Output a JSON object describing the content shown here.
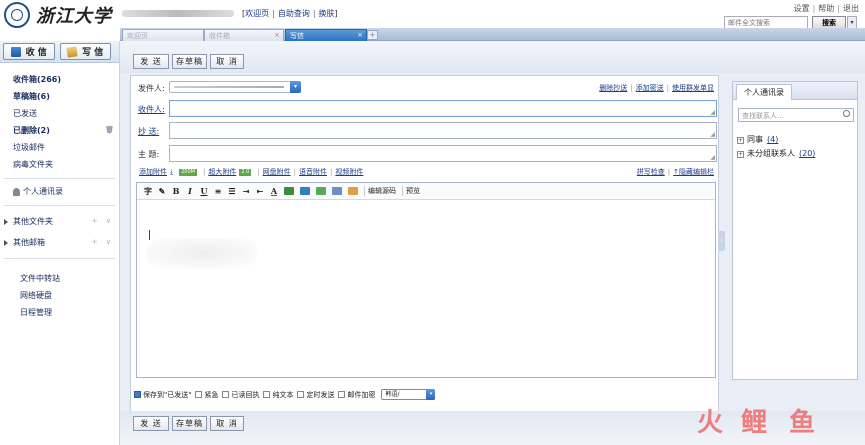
{
  "header": {
    "logo_text": "浙江大学",
    "user_links": [
      "欢迎页",
      "自助查询",
      "换肤"
    ],
    "top_links": [
      "设置",
      "帮助",
      "退出"
    ],
    "search_placeholder": "邮件全文搜索",
    "search_button": "搜索",
    "search_drop_icon": "▾"
  },
  "tabs": [
    {
      "label": "欢迎页",
      "active": false,
      "closable": false
    },
    {
      "label": "收件箱",
      "active": false,
      "closable": true
    },
    {
      "label": "写信",
      "active": true,
      "closable": true
    }
  ],
  "tab_close_icon": "×",
  "tab_new_icon": "+",
  "sidebar": {
    "receive_button": "收 信",
    "compose_button": "写 信",
    "folders": [
      {
        "label": "收件箱(266)",
        "bold": true
      },
      {
        "label": "草稿箱(6)",
        "bold": true
      },
      {
        "label": "已发送",
        "bold": false
      },
      {
        "label": "已删除(2)",
        "bold": true,
        "trash_icon": "🗑"
      },
      {
        "label": "垃圾邮件",
        "bold": false
      },
      {
        "label": "病毒文件夹",
        "bold": false
      }
    ],
    "personal_contacts": "个人通讯录",
    "other_folders": "其他文件夹",
    "other_mailboxes": "其他邮箱",
    "group_actions": "+ ∨",
    "tools": [
      "文件中转站",
      "网络硬盘",
      "日程管理"
    ]
  },
  "actions": {
    "send": "发 送",
    "save_draft": "存草稿",
    "cancel": "取 消"
  },
  "form": {
    "sender_label": "发件人:",
    "sender_dropdown_icon": "▾",
    "to_label": "收件人:",
    "cc_label": "抄  送:",
    "subject_label": "主  题:",
    "resize_grip": "◢",
    "header_links": [
      "删除抄送",
      "添加密送",
      "使用群发单显"
    ],
    "attachments": {
      "add": "添加附件",
      "badge_1": "200M",
      "large": "超大附件",
      "badge_2": "2.0",
      "disk": "网盘附件",
      "voice": "语音附件",
      "video": "视频附件"
    },
    "editor_links": [
      "拼写检查",
      "↑隐藏编辑栏"
    ]
  },
  "editor_toolbar": {
    "buttons": [
      "字",
      "✎",
      "B",
      "I",
      "U",
      "≡",
      "☰",
      "⇥",
      "⇤",
      "A"
    ],
    "edit_source": "编辑源码",
    "preview": "预览"
  },
  "editor_collapse_icon": "‹",
  "options": {
    "save_to_sent": "保存到\"已发送\"",
    "urgent": "紧急",
    "read_receipt": "已读回执",
    "plain_text": "纯文本",
    "scheduled": "定时发送",
    "encrypt": "邮件加密",
    "encoding": "邮件加密 ▾",
    "encoding_value": "韩语/",
    "encoding_drop_icon": "▾"
  },
  "contacts_panel": {
    "tab": "个人通讯录",
    "search_placeholder": "查找联系人...",
    "groups": [
      {
        "label": "同事",
        "count": "(4)"
      },
      {
        "label": "未分组联系人",
        "count": "(20)"
      }
    ],
    "expand_icon": "+"
  },
  "watermark": [
    "火",
    "鲤",
    "鱼"
  ],
  "colors": {
    "accent": "#2d72c0",
    "link": "#1a3c8a",
    "watermark": "#f26a6a"
  }
}
